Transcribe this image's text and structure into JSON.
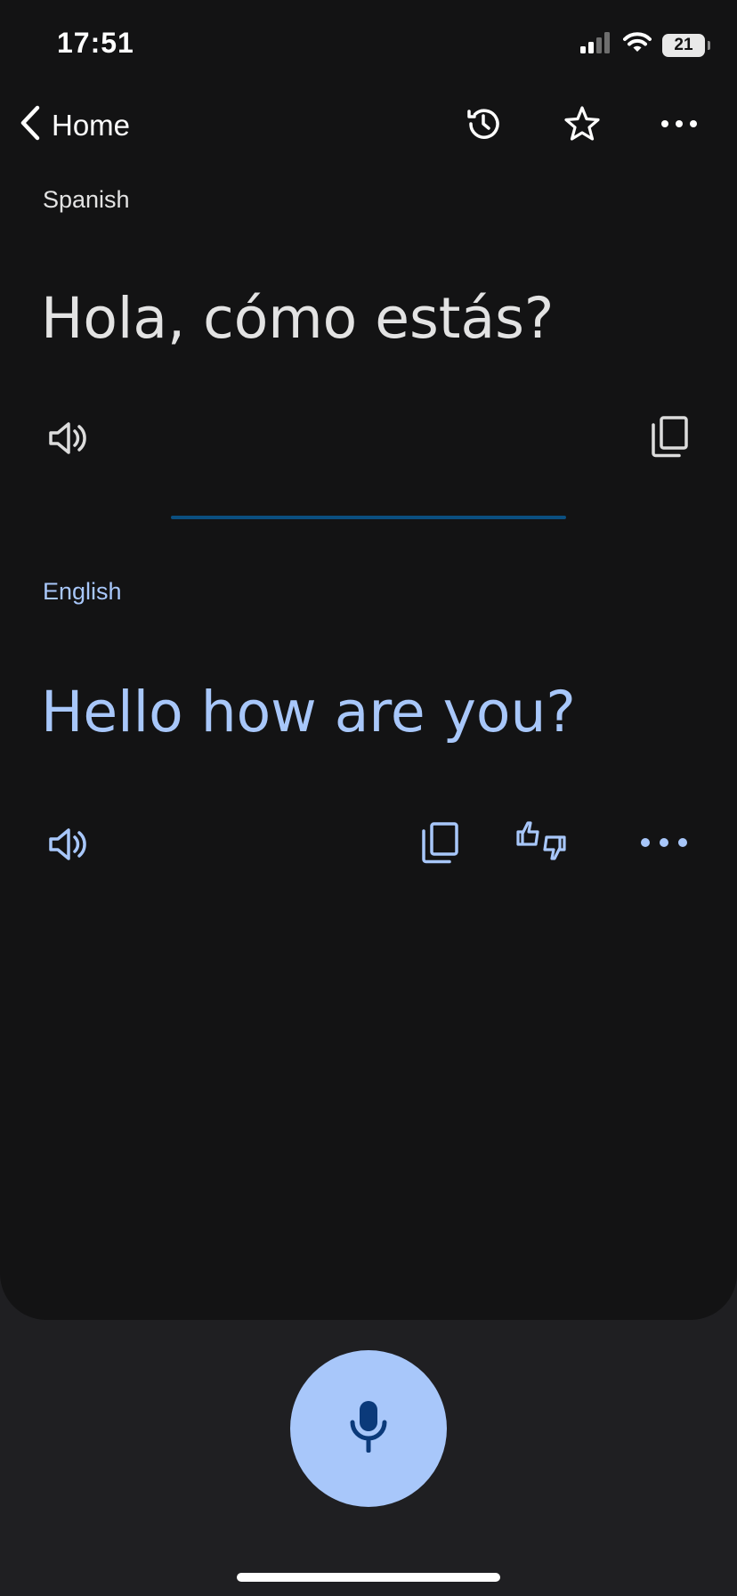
{
  "status_bar": {
    "time": "17:51",
    "battery": "21",
    "icons": [
      "cellular-signal-icon",
      "wifi-icon",
      "battery-icon"
    ]
  },
  "nav": {
    "back_label": "Home",
    "icons": [
      "chevron-left-icon",
      "history-icon",
      "star-icon",
      "more-icon"
    ]
  },
  "source": {
    "language": "Spanish",
    "text": "Hola, cómo estás?",
    "icons": [
      "speaker-icon",
      "copy-icon"
    ]
  },
  "target": {
    "language": "English",
    "text": "Hello how are you?",
    "icons": [
      "speaker-icon",
      "copy-icon",
      "feedback-icon",
      "more-icon"
    ]
  },
  "mic": {
    "icon": "microphone-icon"
  },
  "colors": {
    "card_background": "#131314",
    "page_background": "#1f1f22",
    "accent": "#a8c7fa",
    "primary_text": "#e3e3e3",
    "divider": "#0b4f80",
    "mic_icon": "#0b3a7a"
  }
}
